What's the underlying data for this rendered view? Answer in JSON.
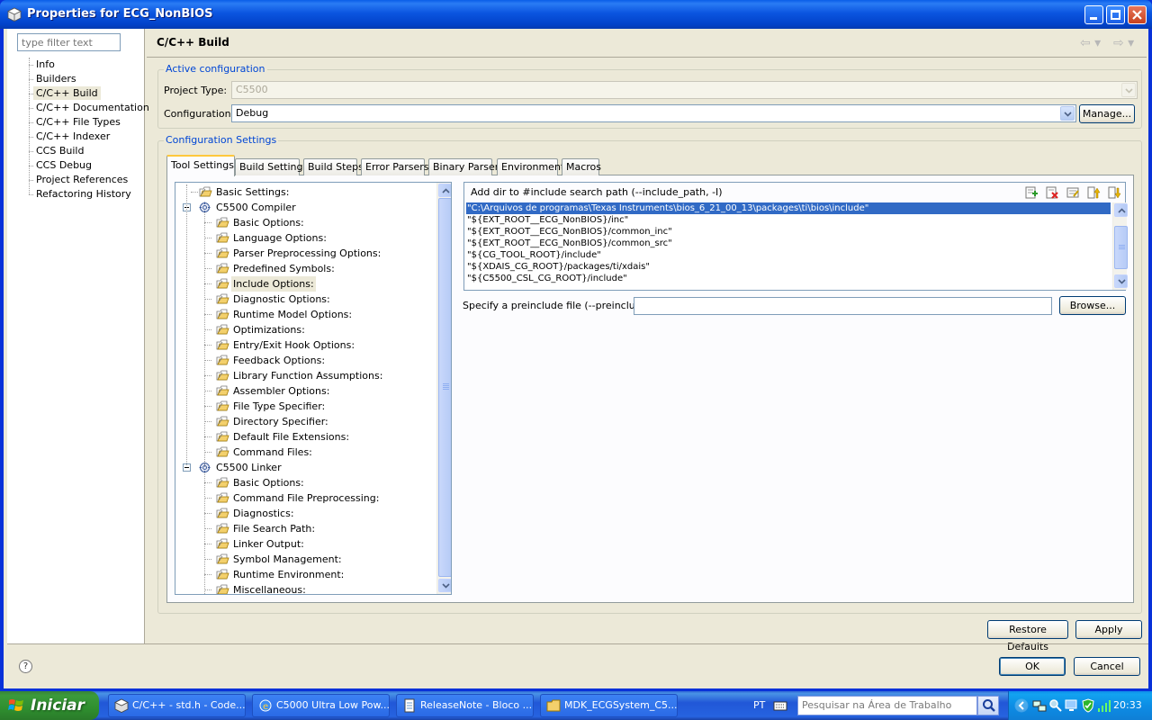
{
  "window": {
    "title": "Properties for ECG_NonBIOS"
  },
  "nav": {
    "filter_placeholder": "type filter text",
    "items": [
      {
        "label": "Info"
      },
      {
        "label": "Builders"
      },
      {
        "label": "C/C++ Build",
        "selected": true
      },
      {
        "label": "C/C++ Documentation"
      },
      {
        "label": "C/C++ File Types"
      },
      {
        "label": "C/C++ Indexer"
      },
      {
        "label": "CCS Build"
      },
      {
        "label": "CCS Debug"
      },
      {
        "label": "Project References"
      },
      {
        "label": "Refactoring History"
      }
    ]
  },
  "page": {
    "title": "C/C++ Build"
  },
  "active_config": {
    "group_label": "Active configuration",
    "project_type_label": "Project Type:",
    "project_type_value": "C5500",
    "configuration_label": "Configuration:",
    "configuration_value": "Debug",
    "manage_label": "Manage..."
  },
  "config_settings": {
    "group_label": "Configuration Settings",
    "tabs": [
      {
        "label": "Tool Settings",
        "active": true
      },
      {
        "label": "Build Settings"
      },
      {
        "label": "Build Steps"
      },
      {
        "label": "Error Parsers"
      },
      {
        "label": "Binary Parser"
      },
      {
        "label": "Environment"
      },
      {
        "label": "Macros"
      }
    ]
  },
  "tree": {
    "basic_settings": "Basic Settings:",
    "compiler": {
      "label": "C5500 Compiler",
      "children": [
        "Basic Options:",
        "Language Options:",
        "Parser Preprocessing Options:",
        "Predefined Symbols:",
        "Include Options:",
        "Diagnostic Options:",
        "Runtime Model Options:",
        "Optimizations:",
        "Entry/Exit Hook Options:",
        "Feedback Options:",
        "Library Function Assumptions:",
        "Assembler Options:",
        "File Type Specifier:",
        "Directory Specifier:",
        "Default File Extensions:",
        "Command Files:"
      ],
      "selected_index": 4
    },
    "linker": {
      "label": "C5500 Linker",
      "children": [
        "Basic Options:",
        "Command File Preprocessing:",
        "Diagnostics:",
        "File Search Path:",
        "Linker Output:",
        "Symbol Management:",
        "Runtime Environment:",
        "Miscellaneous:"
      ]
    }
  },
  "include_panel": {
    "title": "Add dir to #include search path (--include_path, -I)",
    "toolbar_icons": [
      "add-icon",
      "delete-icon",
      "edit-icon",
      "move-up-icon",
      "move-down-icon"
    ],
    "paths": [
      "\"C:\\Arquivos de programas\\Texas Instruments\\bios_6_21_00_13\\packages\\ti\\bios\\include\"",
      "\"${EXT_ROOT__ECG_NonBIOS}/inc\"",
      "\"${EXT_ROOT__ECG_NonBIOS}/common_inc\"",
      "\"${EXT_ROOT__ECG_NonBIOS}/common_src\"",
      "\"${CG_TOOL_ROOT}/include\"",
      "\"${XDAIS_CG_ROOT}/packages/ti/xdais\"",
      "\"${C5500_CSL_CG_ROOT}/include\""
    ],
    "selected_index": 0
  },
  "preinclude": {
    "label": "Specify a preinclude file (--preinclude)",
    "value": "",
    "browse_label": "Browse..."
  },
  "buttons": {
    "restore_defaults": "Restore Defaults",
    "apply": "Apply",
    "ok": "OK",
    "cancel": "Cancel"
  },
  "taskbar": {
    "start_label": "Iniciar",
    "tasks": [
      {
        "label": "C/C++ - std.h - Code..."
      },
      {
        "label": "C5000 Ultra Low Pow..."
      },
      {
        "label": "ReleaseNote - Bloco ..."
      },
      {
        "label": "MDK_ECGSystem_C5..."
      }
    ],
    "language": "PT",
    "search_placeholder": "Pesquisar na Área de Trabalho",
    "clock": "20:33"
  },
  "colors": {
    "selection": "#316ac5",
    "group_label": "#0046d5",
    "dialog_bg": "#ece9d8",
    "title_bar": "#0b55e0"
  }
}
